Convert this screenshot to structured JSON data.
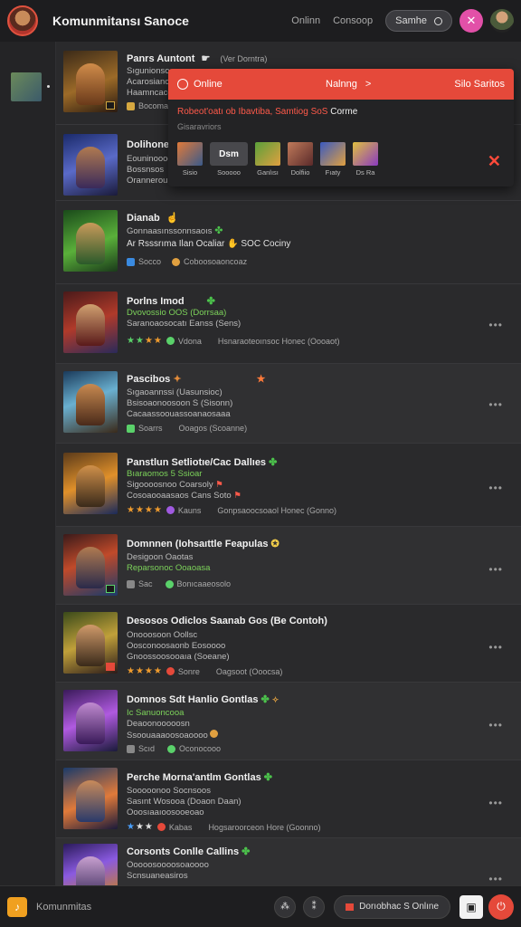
{
  "header": {
    "title": "Komunmitansı Sanoce",
    "link_online": "Onlinn",
    "link_second": "Consoop",
    "pill_label": "Samhe",
    "close_glyph": "✕"
  },
  "popover": {
    "status": "Online",
    "middle": "Nalnng",
    "middle_arrow": ">",
    "right": "Silo Saritos",
    "line1_a": "Robeot'oatı ob Ibavtiba,",
    "line1_b": "Samtiog SoS",
    "line1_c": "Corme",
    "line2": "Gisaravriors",
    "button_label": "Dsm",
    "tiles": [
      "Sisio",
      "",
      "Ganlısı",
      "Dolfiio",
      "Fıaty",
      "Ds Ra"
    ],
    "button_caption": "Sooooo",
    "close_glyph": "✕"
  },
  "games": [
    {
      "title": "Panrs Auntont",
      "tag": "(Ver Dorntra)",
      "sub1": "Sıgunionsoa",
      "sub2": "Acarosiancaoı",
      "sub3": "Haamncacc",
      "meta": "Bocomaoı"
    },
    {
      "title": "Dolihone",
      "sub1": "Eouninoooooo",
      "sub2": "Bossnsos",
      "sub3": "Orannerouba"
    },
    {
      "title": "Dianab",
      "sub1": "Gonnaasınssonnsaoıs",
      "sub2": "Ar Rsssrıma Ilan Ocaliar",
      "sub2b": "SOC Cociny",
      "meta": "Socco",
      "meta2": "Coboosoaoncoaz"
    },
    {
      "title": "Porlns Imod",
      "sub1": "Dvovossio OOS (Dorrsaa)",
      "sub2": "Saranoaosocatı Eanss (Sens)",
      "meta1": "Vdona",
      "meta2": "Hsnaraoteoınsoc Honec (Oooaot)"
    },
    {
      "title": "Pascibos",
      "sub1": "Sıgaoannssi (Uasunsioc)",
      "sub2": "Bsisoaonoosoon S (Sisonn)",
      "sub3": "Cacaassoouassoanaosaaa",
      "meta1": "Soarrs",
      "meta2": "Ooagos (Scoanne)"
    },
    {
      "title": "Panstlun Setliotıe/Cac Dallıes",
      "sub1": "Bıaraomos 5 Ssioar",
      "sub2": "Sigoooosnoo Coarsoly",
      "sub3": "Cosoaooaasaos Cans Soto",
      "meta1": "Kauns",
      "meta2": "Gonpsaoocsoaol Honec (Gonno)"
    },
    {
      "title": "Domnnen (Iohsaıttle Feapulas",
      "sub1": "Desigoon Oaotas",
      "sub2": "Reparsonoc Ooaoasa",
      "meta1": "Sac",
      "meta2": "Bonıcaaeosolo"
    },
    {
      "title": "Desosos Odiclos Saanab Gos (Be Contoh)",
      "sub1": "Onooosoon Oollsc",
      "sub2": "Oosconoosaonb Eosoooo",
      "sub3": "Gnoossoosooaıa (Soeane)",
      "meta1": "Sonre",
      "meta2": "Oagsoot (Ooocsa)"
    },
    {
      "title": "Domnos Sdt Hanlio Gontlas",
      "sub1": "Ic Sanuoncooa",
      "sub2": "Deaoonooooosn",
      "sub3": "Ssoouaaaoosoaoooo",
      "meta1": "Scıd",
      "meta2": "Oconocooo"
    },
    {
      "title": "Perche Morna'antlm Gontlas",
      "sub1": "Sooooonoo Socnsoos",
      "sub2": "Sasınt Wosooa (Doaon Daan)",
      "sub3": "Ooosıaaıoosooeoao",
      "meta1": "Kabas",
      "meta2": "Hogsaroorceon Hore (Goonno)"
    },
    {
      "title": "Corsonts Conlle Callins",
      "sub1": "Ooooosoooosoaoooo",
      "sub2": "Scnsuaneasiros"
    }
  ],
  "bottom": {
    "label": "Komunmitas",
    "logo_glyph": "♪",
    "round1_glyph": "⁂",
    "round2_glyph": "⁑",
    "pill_label": "Dorıobhac S Onlıne",
    "square_glyph": "▣",
    "red_glyph": "⏻"
  },
  "colors": {
    "accent_red": "#e5493a",
    "accent_pink": "#e250a8",
    "star_orange": "#ef9b2e",
    "leaf_green": "#4cc44c",
    "background": "#2a2a2c"
  }
}
